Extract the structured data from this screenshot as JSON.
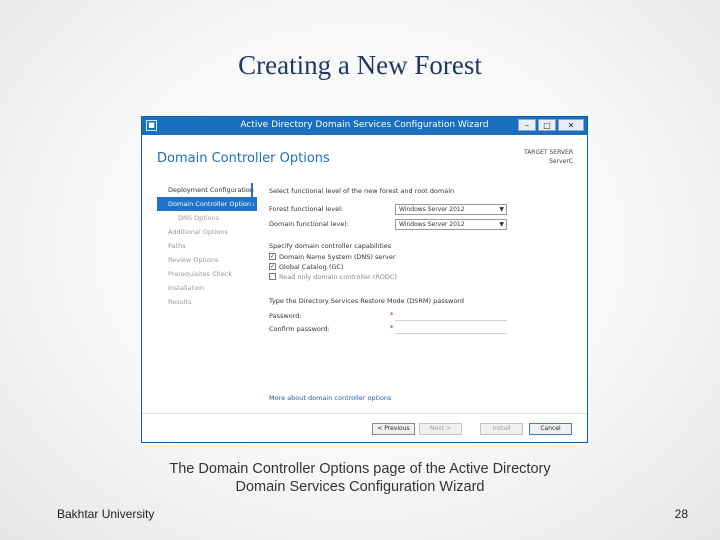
{
  "slide": {
    "title": "Creating a New Forest",
    "caption_line1": "The Domain Controller Options page of the Active Directory",
    "caption_line2": "Domain Services Configuration Wizard",
    "footer_left": "Bakhtar University",
    "page_number": "28"
  },
  "window": {
    "title": "Active Directory Domain Services Configuration Wizard",
    "minimize": "–",
    "maximize": "□",
    "close": "✕",
    "icon": "app-icon"
  },
  "page": {
    "heading": "Domain Controller Options",
    "target_server_label": "TARGET SERVER",
    "target_server_value": "ServerC"
  },
  "nav": {
    "items": [
      {
        "label": "Deployment Configuration",
        "state": "done"
      },
      {
        "label": "Domain Controller Options",
        "state": "active"
      },
      {
        "label": "DNS Options",
        "state": "pending"
      },
      {
        "label": "Additional Options",
        "state": "pending"
      },
      {
        "label": "Paths",
        "state": "pending"
      },
      {
        "label": "Review Options",
        "state": "pending"
      },
      {
        "label": "Prerequisites Check",
        "state": "pending"
      },
      {
        "label": "Installation",
        "state": "pending"
      },
      {
        "label": "Results",
        "state": "pending"
      }
    ]
  },
  "form": {
    "functional_level_heading": "Select functional level of the new forest and root domain",
    "forest_level_label": "Forest functional level:",
    "forest_level_value": "Windows Server 2012",
    "domain_level_label": "Domain functional level:",
    "domain_level_value": "Windows Server 2012",
    "capabilities_heading": "Specify domain controller capabilities",
    "cap_dns": "Domain Name System (DNS) server",
    "cap_dns_checked": true,
    "cap_gc": "Global Catalog (GC)",
    "cap_gc_checked": true,
    "cap_rodc": "Read only domain controller (RODC)",
    "cap_rodc_checked": false,
    "dsrm_heading": "Type the Directory Services Restore Mode (DSRM) password",
    "password_label": "Password:",
    "confirm_label": "Confirm password:",
    "required_mark": "*",
    "more_link": "More about domain controller options"
  },
  "buttons": {
    "previous": "< Previous",
    "next": "Next >",
    "install": "Install",
    "cancel": "Cancel"
  },
  "colors": {
    "title": "#1f3864",
    "titlebar": "#1a6fc0",
    "accent": "#1e73c8"
  }
}
